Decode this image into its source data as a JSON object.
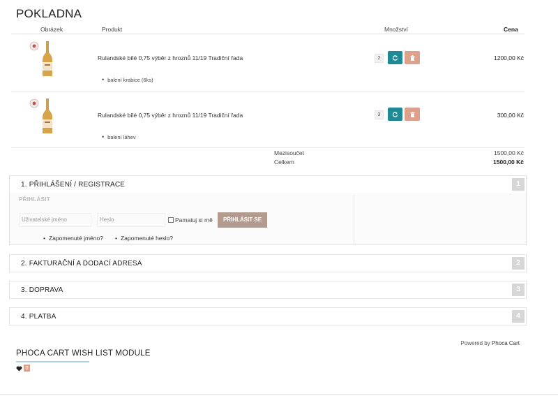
{
  "page": {
    "title": "POKLADNA"
  },
  "table": {
    "headers": {
      "image": "Obrázek",
      "product": "Produkt",
      "quantity": "Množství",
      "price": "Cena"
    }
  },
  "items": [
    {
      "name": "Rulandské bílé 0,75 výběr z hroznů 11/19 Tradiční řada",
      "option": "balení krabice (6ks)",
      "quantity": "2",
      "price": "1200,00 Kč"
    },
    {
      "name": "Rulandské bílé 0,75 výběr z hroznů 11/19 Tradiční řada",
      "option": "balení láhev",
      "quantity": "3",
      "price": "300,00 Kč"
    }
  ],
  "summary": {
    "subtotal_label": "Mezisoučet",
    "subtotal_value": "1500,00 Kč",
    "total_label": "Celkem",
    "total_value": "1500,00 Kč"
  },
  "steps": [
    {
      "title": "1. PŘIHLÁŠENÍ / REGISTRACE",
      "number": "1"
    },
    {
      "title": "2. FAKTURAČNÍ A DODACÍ ADRESA",
      "number": "2"
    },
    {
      "title": "3. DOPRAVA",
      "number": "3"
    },
    {
      "title": "4. PLATBA",
      "number": "4"
    }
  ],
  "login": {
    "section_label": "PŘIHLÁSIT",
    "username_placeholder": "Uživatelské jméno",
    "password_placeholder": "Heslo",
    "remember_label": "Pamatuj si mě",
    "login_button": "PŘIHLÁSIT SE",
    "forgot_username": "Zapomenuté jméno?",
    "forgot_password": "Zapomenuté heslo?"
  },
  "footer": {
    "powered_prefix": "Powered by",
    "powered_brand": "Phoca Cart"
  },
  "wishlist": {
    "title": "PHOCA CART WISH LIST MODULE",
    "count": "0"
  },
  "icons": {
    "refresh": "refresh-icon",
    "delete": "trash-icon",
    "heart": "heart-icon"
  },
  "colors": {
    "refresh": "#1f8a96",
    "delete": "#dda08c",
    "login_button": "#b49b8f"
  }
}
